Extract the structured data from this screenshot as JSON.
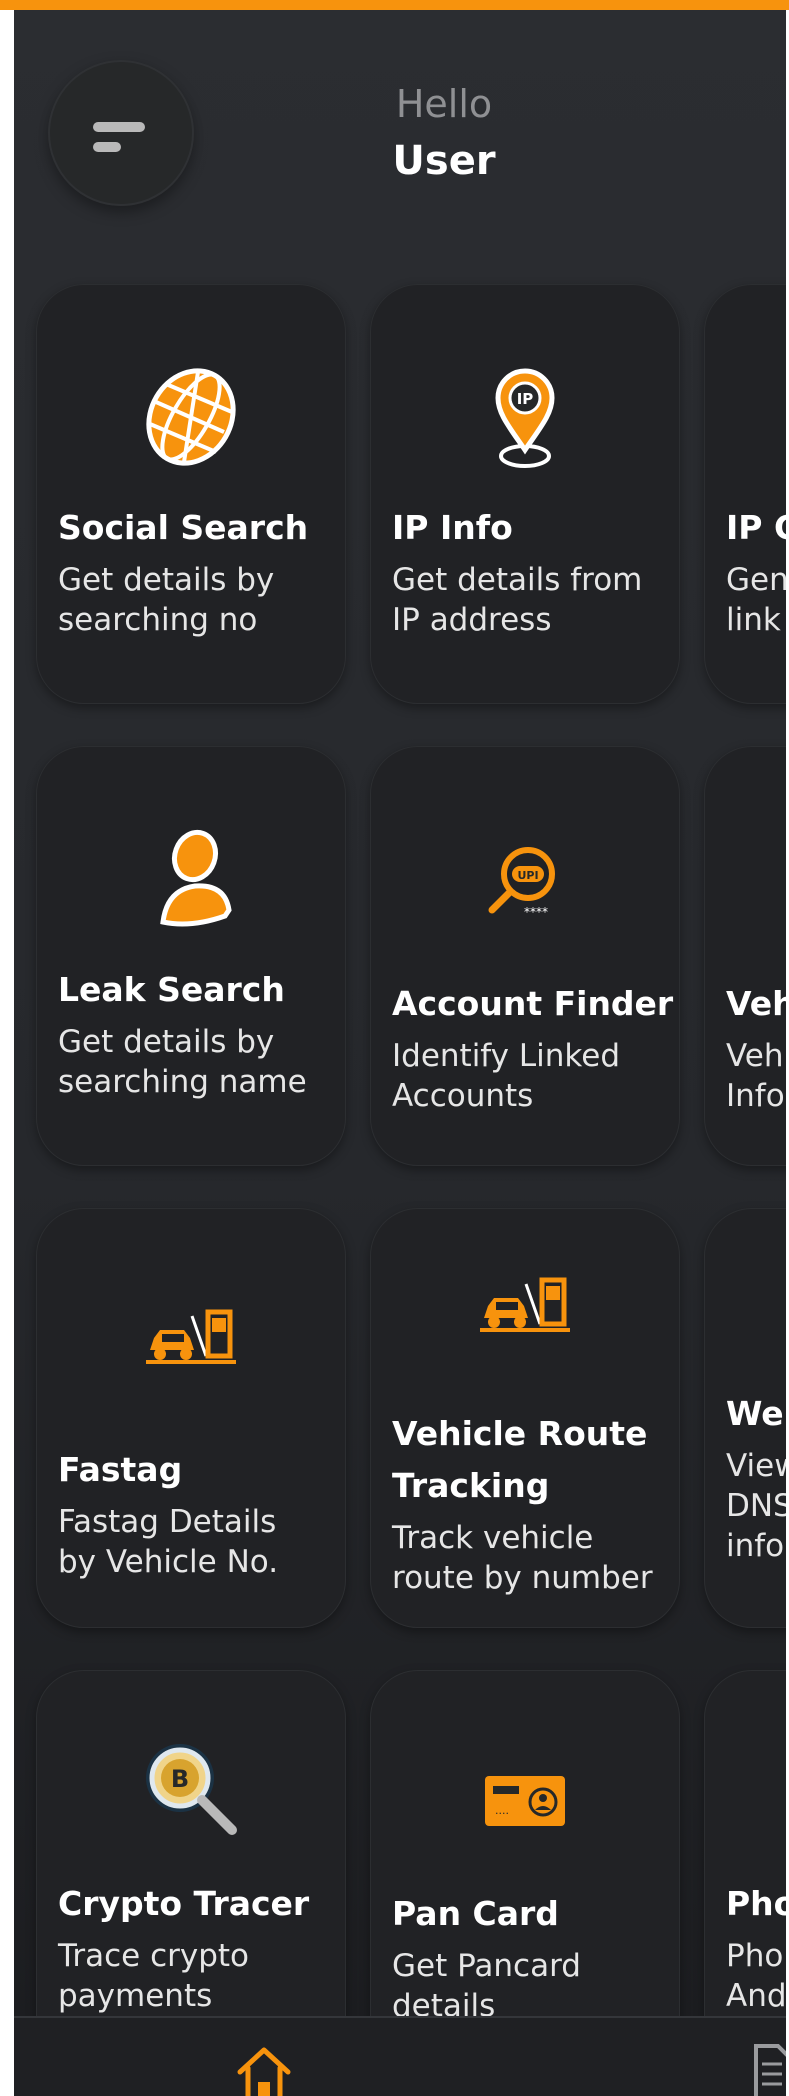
{
  "header": {
    "greeting": "Hello",
    "username": "User"
  },
  "cards": [
    {
      "title": "Social Search",
      "desc_1": "Get details by",
      "desc_2": "searching no",
      "icon": "globe-icon"
    },
    {
      "title": "IP Info",
      "desc_1": "Get details from",
      "desc_2": "IP address",
      "icon": "location-pin-icon"
    },
    {
      "title": "IP G",
      "desc_1": "Gen",
      "desc_2": "link",
      "icon": ""
    },
    {
      "title": "Leak Search",
      "desc_1": "Get details by",
      "desc_2": "searching name",
      "icon": "user-icon"
    },
    {
      "title": "Account Finder",
      "desc_1": "Identify Linked",
      "desc_2": "Accounts",
      "icon": "upi-search-icon"
    },
    {
      "title": "Veh",
      "desc_1": "Veh",
      "desc_2": "Info",
      "icon": ""
    },
    {
      "title": "Fastag",
      "desc_1": "Fastag Details",
      "desc_2": "by Vehicle No.",
      "icon": "toll-booth-car-icon"
    },
    {
      "title_1": "Vehicle Route",
      "title_2": "Tracking",
      "desc_1": "Track vehicle",
      "desc_2": "route by number",
      "icon": "toll-booth-car-icon"
    },
    {
      "title": "We",
      "desc_1": "View",
      "desc_2": "DNS",
      "desc_3": "info",
      "icon": ""
    },
    {
      "title": "Crypto Tracer",
      "desc_1": "Trace crypto",
      "desc_2": "payments",
      "icon": "bitcoin-search-icon"
    },
    {
      "title": "Pan Card",
      "desc_1": "Get Pancard",
      "desc_2": "details",
      "icon": "id-card-icon"
    },
    {
      "title": "Pho",
      "desc_1": "Pho",
      "desc_2": "And",
      "icon": ""
    }
  ],
  "bottom_nav": {
    "items": [
      "home-icon",
      "list-icon"
    ]
  },
  "colors": {
    "accent": "#f7930d",
    "background": "#2a2c30",
    "card": "#212225"
  }
}
